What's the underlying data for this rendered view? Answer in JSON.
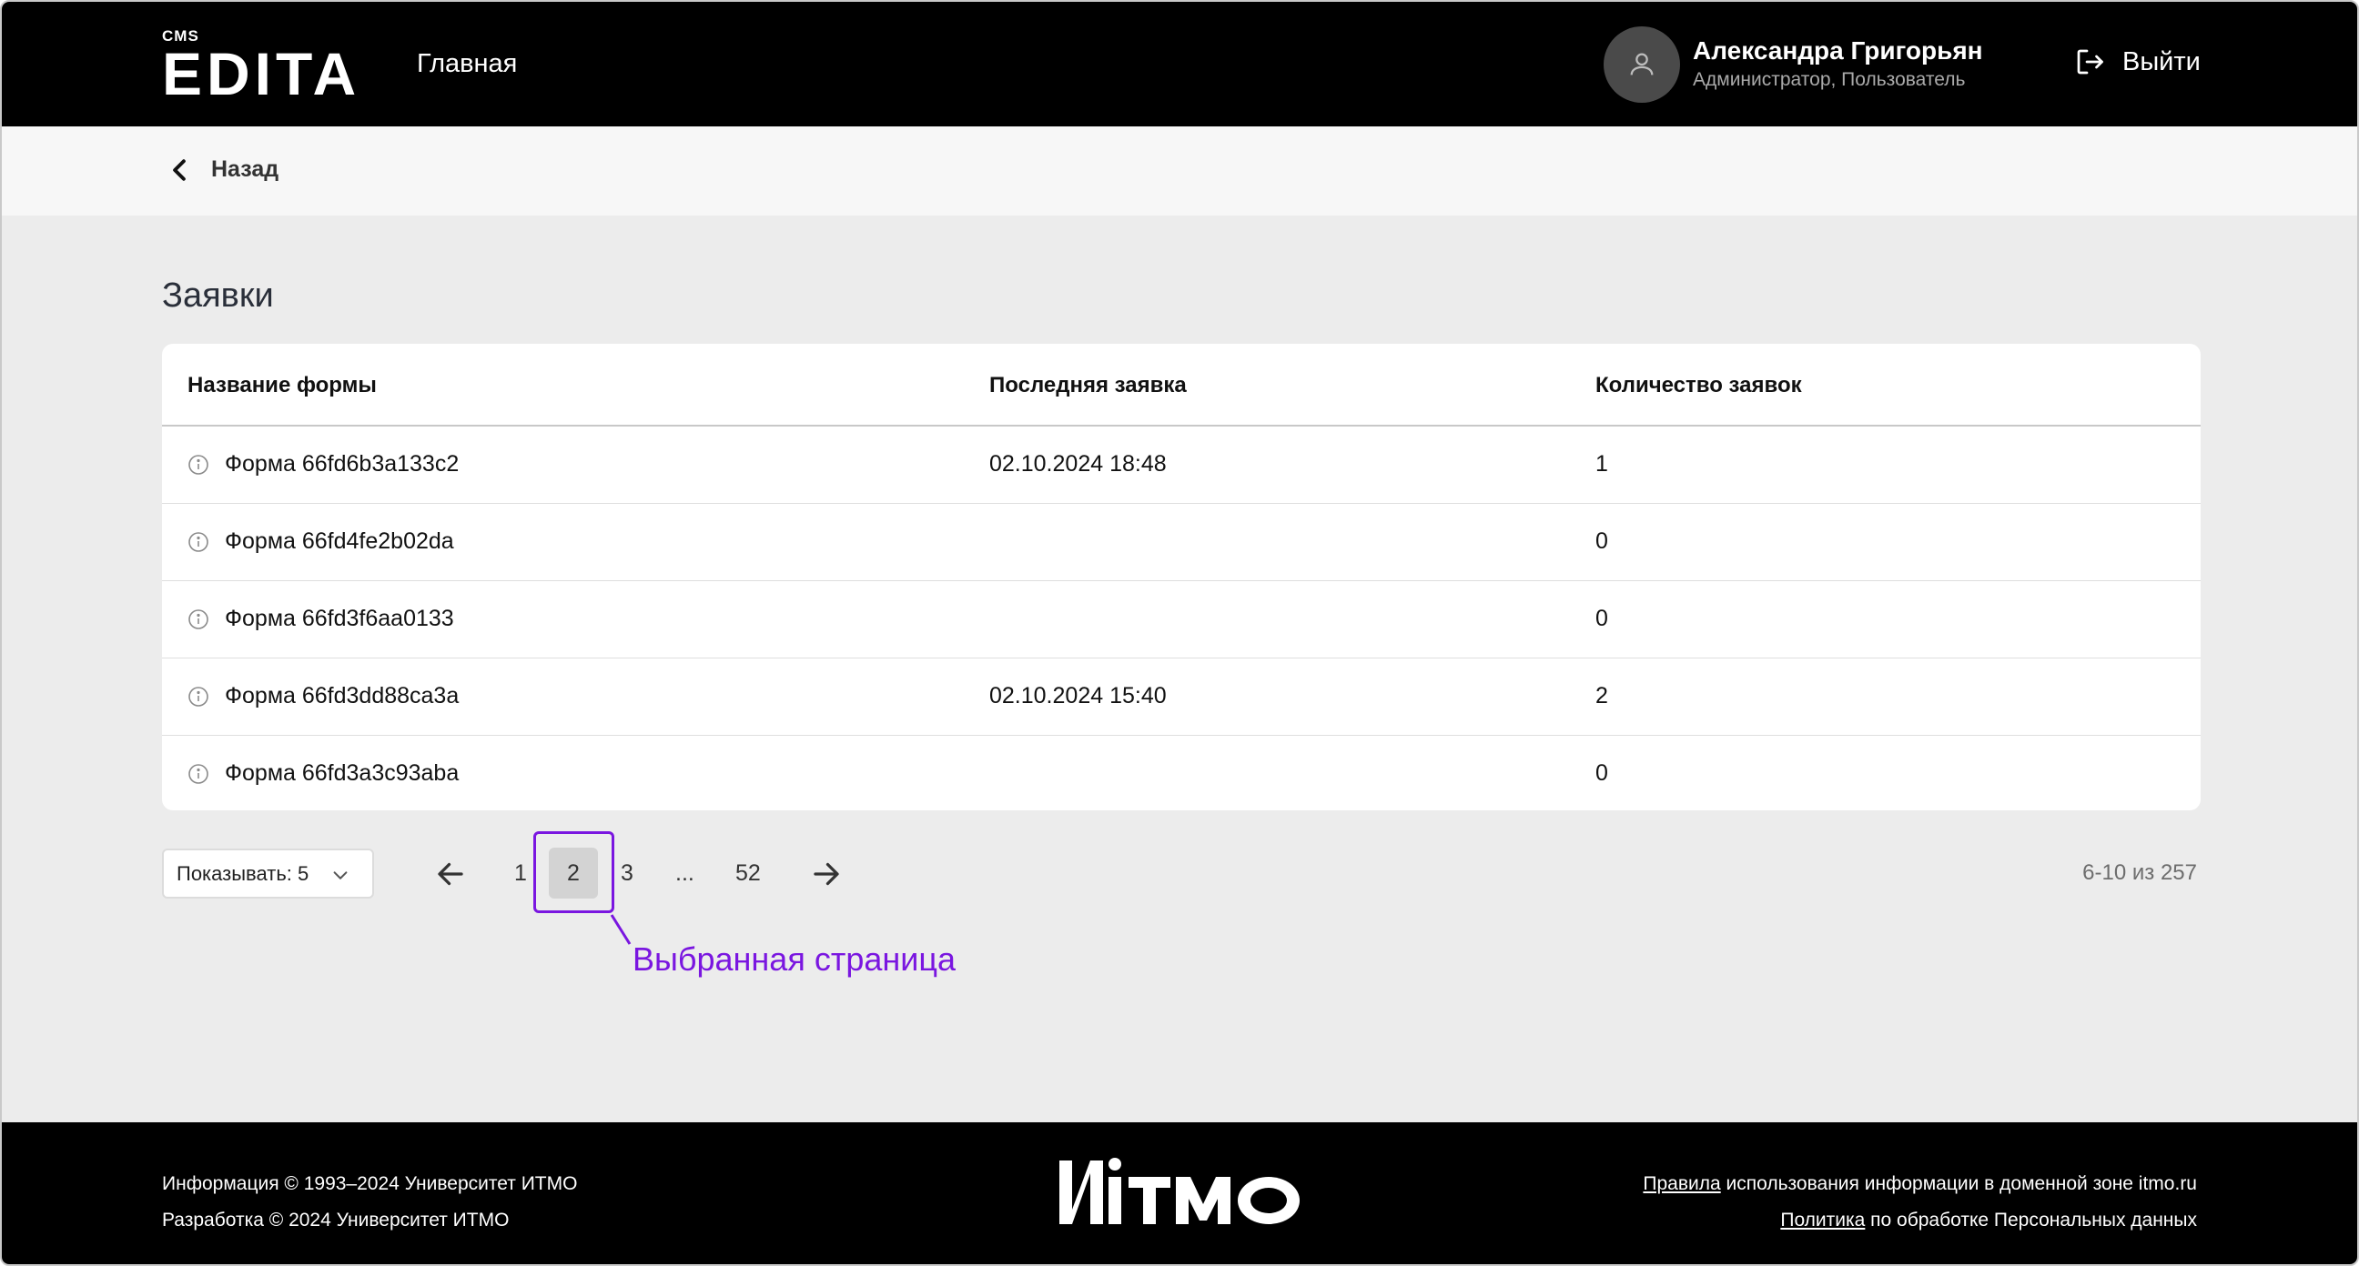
{
  "header": {
    "logo_small": "CMS",
    "logo_main": "EDITA",
    "nav_home": "Главная",
    "user_name": "Александра Григорьян",
    "user_role": "Администратор, Пользователь",
    "logout_label": "Выйти"
  },
  "backbar": {
    "back_label": "Назад"
  },
  "page": {
    "title": "Заявки"
  },
  "table": {
    "columns": [
      "Название формы",
      "Последняя заявка",
      "Количество заявок"
    ],
    "rows": [
      {
        "name": "Форма 66fd6b3a133c2",
        "last": "02.10.2024 18:48",
        "count": "1"
      },
      {
        "name": "Форма 66fd4fe2b02da",
        "last": "",
        "count": "0"
      },
      {
        "name": "Форма 66fd3f6aa0133",
        "last": "",
        "count": "0"
      },
      {
        "name": "Форма 66fd3dd88ca3a",
        "last": "02.10.2024 15:40",
        "count": "2"
      },
      {
        "name": "Форма 66fd3a3c93aba",
        "last": "",
        "count": "0"
      }
    ]
  },
  "pagination": {
    "per_page_label": "Показывать: 5",
    "pages": [
      "1",
      "2",
      "3",
      "...",
      "52"
    ],
    "current_page": "2",
    "range_text": "6-10 из 257",
    "callout": "Выбранная страница"
  },
  "footer": {
    "info_line": "Информация © 1993–2024 Университет ИТМО",
    "dev_line": "Разработка © 2024 Университет ИТМО",
    "rules_link": "Правила",
    "rules_text": " использования информации в доменной зоне itmo.ru",
    "policy_link": "Политика",
    "policy_text": " по обработке Персональных данных",
    "logo_text": "ИТМО"
  },
  "colors": {
    "header_bg": "#000000",
    "page_bg": "#ececec",
    "accent": "#7a16e0",
    "current_page_bg": "#d3d3d3"
  }
}
